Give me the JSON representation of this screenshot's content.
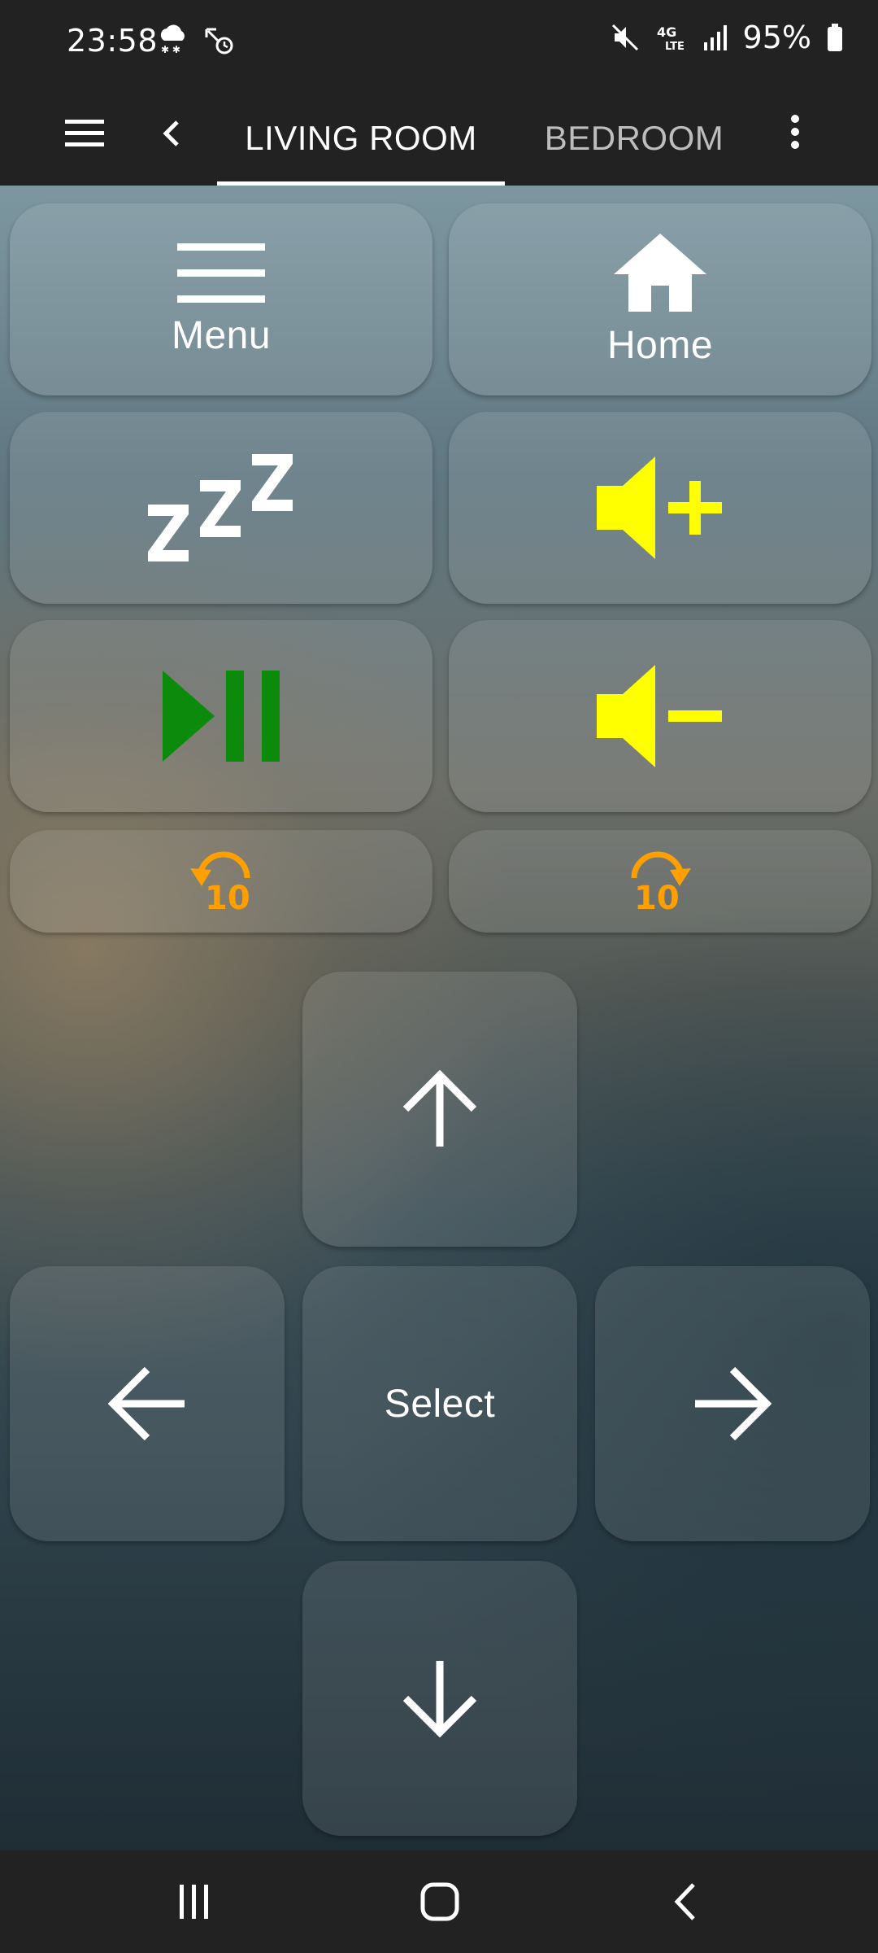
{
  "status_bar": {
    "time": "23:58",
    "battery": "95%",
    "left_icons": [
      "snow-cloud-icon",
      "sync-alarm-icon"
    ],
    "right_icons": [
      "mute-icon",
      "4g-lte-icon",
      "signal-icon",
      "battery-icon"
    ],
    "network_label": "4G LTE"
  },
  "tab_bar": {
    "tabs": [
      {
        "label": "LIVING ROOM",
        "active": true
      },
      {
        "label": "BEDROOM",
        "active": false
      }
    ]
  },
  "remote": {
    "menu_label": "Menu",
    "home_label": "Home",
    "select_label": "Select",
    "rewind_seconds": "10",
    "forward_seconds": "10",
    "sleep_glyph": "zZZ"
  },
  "colors": {
    "volume_icon": "#ffff00",
    "play_pause_icon": "#0b8a0b",
    "skip_icon": "#ffa000",
    "bar_background": "#222222"
  }
}
